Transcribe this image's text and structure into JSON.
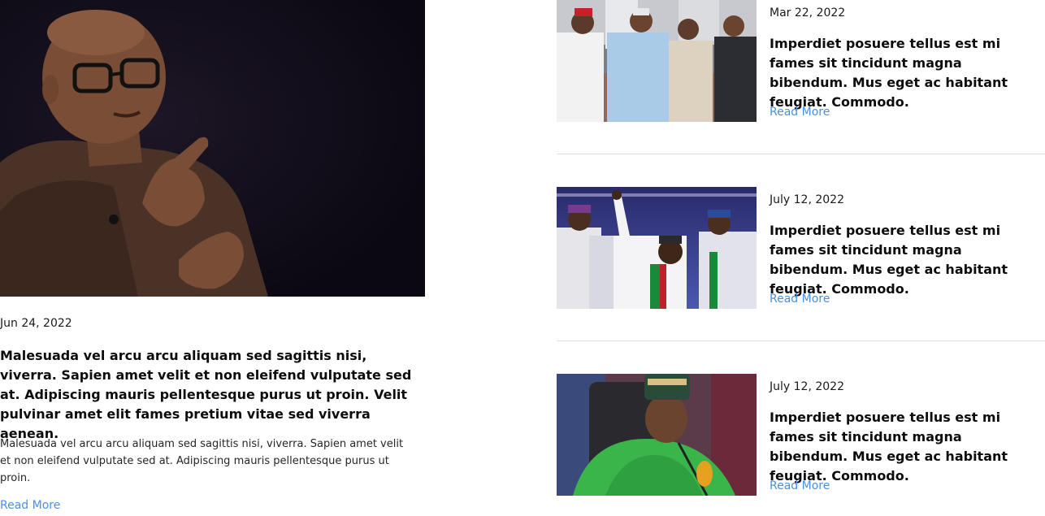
{
  "featured": {
    "date": "Jun 24, 2022",
    "title": "Malesuada vel arcu arcu aliquam sed sagittis nisi, viverra. Sapien amet velit et non eleifend vulputate sed at. Adipiscing mauris pellentesque purus ut proin. Velit pulvinar amet elit fames pretium vitae sed viverra aenean.",
    "excerpt": "Malesuada vel arcu arcu aliquam sed sagittis nisi, viverra. Sapien amet velit et non eleifend vulputate sed at. Adipiscing mauris pellentesque purus ut proin.",
    "read_more": "Read More"
  },
  "posts": [
    {
      "date": "Mar 22, 2022",
      "title": "Imperdiet posuere tellus est mi fames sit tincidunt magna bibendum. Mus eget ac habitant feugiat. Commodo.",
      "read_more": "Read More"
    },
    {
      "date": "July 12, 2022",
      "title": "Imperdiet posuere tellus est mi fames sit tincidunt magna bibendum. Mus eget ac habitant feugiat. Commodo.",
      "read_more": "Read More"
    },
    {
      "date": "July 12, 2022",
      "title": "Imperdiet posuere tellus est mi fames sit tincidunt magna bibendum. Mus eget ac habitant feugiat. Commodo.",
      "read_more": "Read More"
    }
  ],
  "colors": {
    "link": "#4a90e2",
    "divider": "#dedede",
    "text": "#0d0d0d"
  }
}
